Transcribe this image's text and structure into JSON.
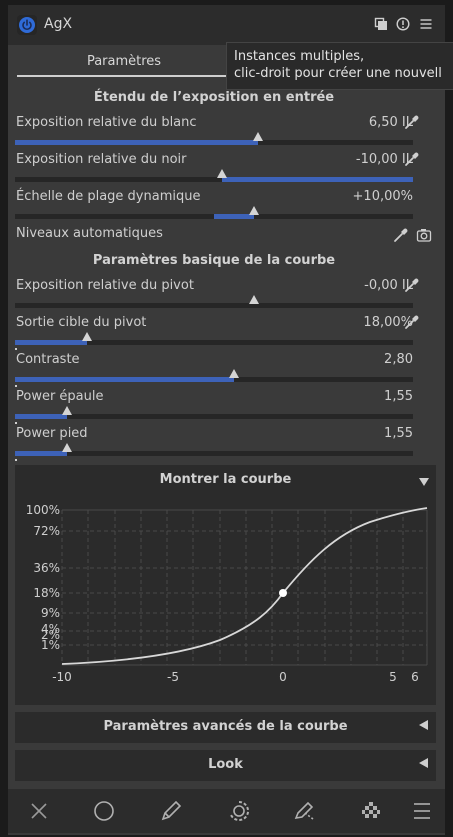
{
  "module": {
    "title": "AgX",
    "icons": [
      "multi-instance-icon",
      "reset-icon",
      "presets-icon"
    ]
  },
  "tabs": [
    {
      "label": "Paramètres"
    }
  ],
  "tooltip": {
    "line1": "Instances multiples,",
    "line2": "clic-droit pour créer une nouvell"
  },
  "section1": {
    "title": "Étendu de l’exposition en entrée"
  },
  "white": {
    "label": "Exposition relative du blanc",
    "value": "6,50 IL"
  },
  "black": {
    "label": "Exposition relative du noir",
    "value": "-10,00 IL"
  },
  "range": {
    "label": "Échelle de plage dynamique",
    "value": "+10,00%"
  },
  "auto": {
    "label": "Niveaux automatiques"
  },
  "section2": {
    "title": "Paramètres basique de la courbe"
  },
  "pivot_exp": {
    "label": "Exposition relative du pivot",
    "value": "-0,00 IL"
  },
  "pivot_out": {
    "label": "Sortie cible du pivot",
    "value": "18,00%"
  },
  "contrast": {
    "label": "Contraste",
    "value": "2,80"
  },
  "shoulder": {
    "label": "Power épaule",
    "value": "1,55"
  },
  "toe": {
    "label": "Power pied",
    "value": "1,55"
  },
  "sliders": {
    "white": {
      "fill_from": 0,
      "fill_to": 0.61,
      "marker": 0.61
    },
    "black": {
      "fill_from": 0.52,
      "fill_to": 1,
      "marker": 0.52
    },
    "range": {
      "fill_from": 0.5,
      "fill_to": 0.6,
      "marker": 0.6
    },
    "pivot_exp": {
      "fill_from": 0.6,
      "fill_to": 0.6,
      "marker": 0.6
    },
    "pivot_out": {
      "fill_from": 0,
      "fill_to": 0.18,
      "marker": 0.18
    },
    "contrast": {
      "fill_from": 0,
      "fill_to": 0.55,
      "marker": 0.55
    },
    "shoulder": {
      "fill_from": 0,
      "fill_to": 0.13,
      "marker": 0.13
    },
    "toe": {
      "fill_from": 0,
      "fill_to": 0.13,
      "marker": 0.13
    }
  },
  "curve": {
    "title": "Montrer la courbe",
    "y_ticks": [
      "100%",
      "72%",
      "36%",
      "18%",
      "9%",
      "4%",
      "2%",
      "1%"
    ],
    "x_ticks": [
      "-10",
      "-5",
      "0",
      "5",
      "6"
    ]
  },
  "advanced": {
    "title": "Paramètres avancés de la courbe"
  },
  "look": {
    "title": "Look"
  },
  "bottom_icons": [
    "close-icon",
    "circle-icon",
    "pencil-icon",
    "drawn-parametric-icon",
    "pencil-ruler-icon",
    "raster-mask-icon",
    "menu-icon"
  ],
  "colors": {
    "accent": "#3d62b8",
    "panel": "#3a3a3a",
    "power": "#2f6bd8"
  }
}
